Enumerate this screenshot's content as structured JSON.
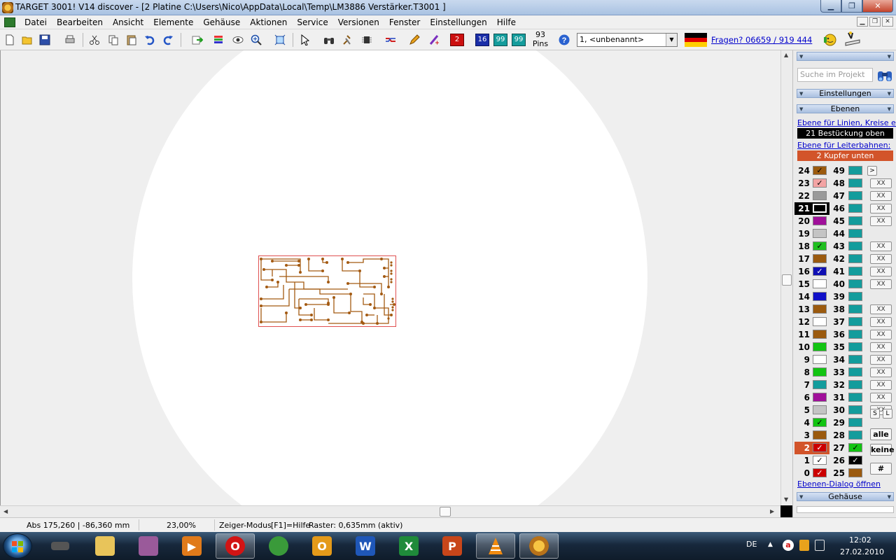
{
  "window": {
    "title": "TARGET 3001! V14 discover - [2 Platine C:\\Users\\Nico\\AppData\\Local\\Temp\\LM3886 Verstärker.T3001 ]",
    "minimize": "▁",
    "maximize": "❐",
    "close": "✕"
  },
  "menu": {
    "items": [
      "Datei",
      "Bearbeiten",
      "Ansicht",
      "Elemente",
      "Gehäuse",
      "Aktionen",
      "Service",
      "Versionen",
      "Fenster",
      "Einstellungen",
      "Hilfe"
    ],
    "mdi_min": "▁",
    "mdi_restore": "❐",
    "mdi_close": "✕"
  },
  "toolbar": {
    "pins_count": "93",
    "pins_label": "Pins",
    "combo_value": "1, <unbenannt>",
    "help_link": "Fragen? 06659 / 919 444",
    "badge_2": "2",
    "badge_16": "16",
    "badge_99a": "99",
    "badge_99b": "99"
  },
  "side_panel": {
    "search_placeholder": "Suche im Projekt",
    "settings_header": "Einstellungen",
    "layers_header": "Ebenen",
    "lines_link": "Ebene für Linien, Kreise etc.:",
    "lines_layer": "21 Bestückung oben",
    "tracks_link": "Ebene für Leiterbahnen:",
    "tracks_layer": "2 Kupfer unten",
    "dialog_link": "Ebenen-Dialog öffnen",
    "housing_header": "Gehäuse",
    "btn_s": "S",
    "btn_l": "L",
    "btn_all": "alle",
    "btn_none": "keine",
    "btn_hash": "#",
    "btn_more": ">",
    "xbtn_label": "XX"
  },
  "layers": {
    "left": [
      {
        "num": "24",
        "color": "#9b5a0e",
        "check": "✓"
      },
      {
        "num": "23",
        "color": "#f3a4a4",
        "check": "✓"
      },
      {
        "num": "22",
        "color": "#9a9a9a",
        "check": ""
      },
      {
        "num": "21",
        "color": "#000000",
        "check": ""
      },
      {
        "num": "20",
        "color": "#a0109a",
        "check": ""
      },
      {
        "num": "19",
        "color": "#c4c4c4",
        "check": ""
      },
      {
        "num": "18",
        "color": "#1fbf1f",
        "check": "✓"
      },
      {
        "num": "17",
        "color": "#9b5a0e",
        "check": ""
      },
      {
        "num": "16",
        "color": "#1010b4",
        "check": "✓"
      },
      {
        "num": "15",
        "color": "#ffffff",
        "check": ""
      },
      {
        "num": "14",
        "color": "#1010c8",
        "check": ""
      },
      {
        "num": "13",
        "color": "#9b5a0e",
        "check": ""
      },
      {
        "num": "12",
        "color": "#ffffff",
        "check": ""
      },
      {
        "num": "11",
        "color": "#9b5a0e",
        "check": ""
      },
      {
        "num": "10",
        "color": "#12c412",
        "check": ""
      },
      {
        "num": "9",
        "color": "#ffffff",
        "check": ""
      },
      {
        "num": "8",
        "color": "#12c412",
        "check": ""
      },
      {
        "num": "7",
        "color": "#139c9c",
        "check": ""
      },
      {
        "num": "6",
        "color": "#a0109a",
        "check": ""
      },
      {
        "num": "5",
        "color": "#c4c4c4",
        "check": ""
      },
      {
        "num": "4",
        "color": "#12c412",
        "check": "✓"
      },
      {
        "num": "3",
        "color": "#9b5a0e",
        "check": ""
      },
      {
        "num": "2",
        "color": "#cc0000",
        "check": "✓"
      },
      {
        "num": "1",
        "color": "#ffffff",
        "check": "✓"
      },
      {
        "num": "0",
        "color": "#cc0000",
        "check": "✓"
      }
    ],
    "right": [
      {
        "num": "49",
        "color": "#139c9c",
        "check": ""
      },
      {
        "num": "48",
        "color": "#139c9c",
        "check": ""
      },
      {
        "num": "47",
        "color": "#139c9c",
        "check": ""
      },
      {
        "num": "46",
        "color": "#139c9c",
        "check": ""
      },
      {
        "num": "45",
        "color": "#139c9c",
        "check": ""
      },
      {
        "num": "44",
        "color": "#139c9c",
        "check": ""
      },
      {
        "num": "43",
        "color": "#139c9c",
        "check": ""
      },
      {
        "num": "42",
        "color": "#139c9c",
        "check": ""
      },
      {
        "num": "41",
        "color": "#139c9c",
        "check": ""
      },
      {
        "num": "40",
        "color": "#139c9c",
        "check": ""
      },
      {
        "num": "39",
        "color": "#139c9c",
        "check": ""
      },
      {
        "num": "38",
        "color": "#139c9c",
        "check": ""
      },
      {
        "num": "37",
        "color": "#139c9c",
        "check": ""
      },
      {
        "num": "36",
        "color": "#139c9c",
        "check": ""
      },
      {
        "num": "35",
        "color": "#139c9c",
        "check": ""
      },
      {
        "num": "34",
        "color": "#139c9c",
        "check": ""
      },
      {
        "num": "33",
        "color": "#139c9c",
        "check": ""
      },
      {
        "num": "32",
        "color": "#139c9c",
        "check": ""
      },
      {
        "num": "31",
        "color": "#139c9c",
        "check": ""
      },
      {
        "num": "30",
        "color": "#139c9c",
        "check": ""
      },
      {
        "num": "29",
        "color": "#139c9c",
        "check": ""
      },
      {
        "num": "28",
        "color": "#139c9c",
        "check": ""
      },
      {
        "num": "27",
        "color": "#12c412",
        "check": "✓"
      },
      {
        "num": "26",
        "color": "#000000",
        "check": "✓"
      },
      {
        "num": "25",
        "color": "#9b5a0e",
        "check": ""
      }
    ]
  },
  "status": {
    "coords": "Abs 175,260 | -86,360 mm",
    "zoom": "23,00%",
    "mode": "Zeiger-Modus",
    "help": "[F1]=Hilfe",
    "grid": "Raster: 0,635mm (aktiv)"
  },
  "taskbar": {
    "lang": "DE",
    "time": "12:02",
    "date": "27.02.2010",
    "tray_arrow": "▲"
  },
  "colors": {
    "pcb_track": "#a35a12",
    "pcb_outline": "#e05050",
    "selected_layer_bg": "#d2542a"
  }
}
